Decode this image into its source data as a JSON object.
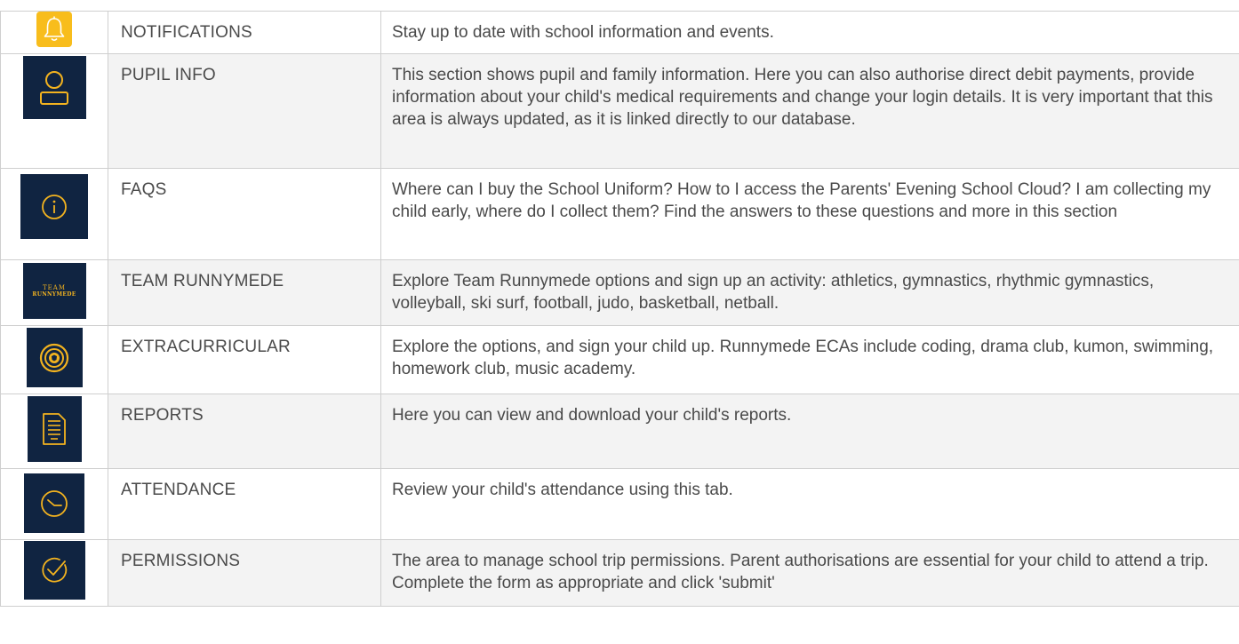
{
  "accent_color": "#f3b31f",
  "tile_color": "#102441",
  "rows": [
    {
      "name": "NOTIFICATIONS",
      "icon": "bell-icon",
      "description": "Stay up to date with school information and events."
    },
    {
      "name": "PUPIL INFO",
      "icon": "user-icon",
      "description": "This section shows pupil and family information. Here you can also authorise direct debit payments, provide information about your child's medical requirements and change your login details. It is very important that this area is always updated, as it is linked directly to our database."
    },
    {
      "name": "FAQS",
      "icon": "info-icon",
      "description": "Where can I buy the School Uniform? How to I access the Parents' Evening School Cloud? I am collecting my child early, where do I collect them? Find the answers to these questions and more in this section"
    },
    {
      "name": "TEAM RUNNYMEDE",
      "icon": "team-runnymede-logo",
      "logo_line1": "TEAM",
      "logo_line2": "RUNNYMEDE",
      "description": "Explore Team Runnymede options and sign up an activity: athletics, gymnastics, rhythmic gymnastics, volleyball, ski surf, football, judo, basketball, netball."
    },
    {
      "name": "EXTRACURRICULAR",
      "icon": "target-icon",
      "description": "Explore the options, and sign your child up. Runnymede ECAs include coding, drama club, kumon, swimming, homework club, music academy."
    },
    {
      "name": "REPORTS",
      "icon": "document-icon",
      "description": "Here you can view and download your child's reports."
    },
    {
      "name": "ATTENDANCE",
      "icon": "clock-icon",
      "description": "Review your child's attendance using this tab."
    },
    {
      "name": "PERMISSIONS",
      "icon": "check-circle-icon",
      "description": "The area to manage school trip permissions. Parent authorisations are essential for your child to attend a trip. Complete the form as appropriate and click 'submit'"
    }
  ]
}
